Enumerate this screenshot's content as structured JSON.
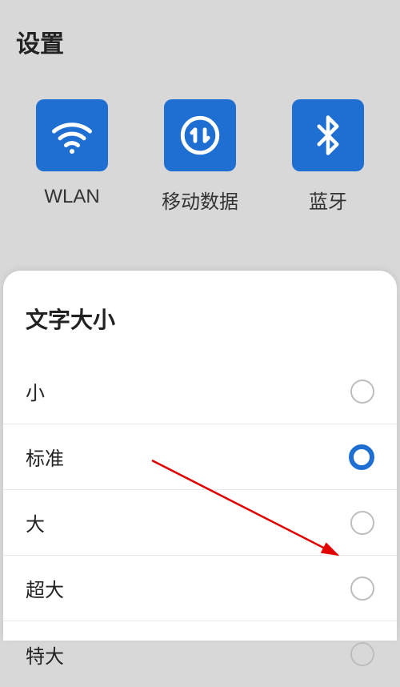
{
  "header": {
    "title": "设置"
  },
  "quick_tiles": {
    "wlan": {
      "label": "WLAN",
      "icon": "wifi-icon"
    },
    "data": {
      "label": "移动数据",
      "icon": "data-transfer-icon"
    },
    "bt": {
      "label": "蓝牙",
      "icon": "bluetooth-icon"
    }
  },
  "panel": {
    "title": "文字大小",
    "options": [
      {
        "label": "小",
        "selected": false
      },
      {
        "label": "标准",
        "selected": true
      },
      {
        "label": "大",
        "selected": false
      },
      {
        "label": "超大",
        "selected": false
      },
      {
        "label": "特大",
        "selected": false
      }
    ]
  },
  "colors": {
    "accent": "#1f6fd3"
  }
}
